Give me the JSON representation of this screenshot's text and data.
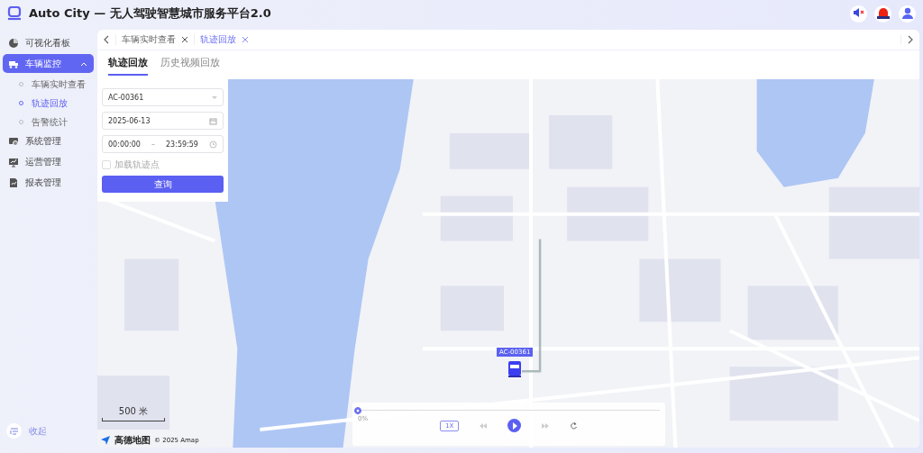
{
  "header": {
    "title": "Auto City — 无人驾驶智慧城市服务平台2.0"
  },
  "sidebar": {
    "items": [
      {
        "label": "可视化看板",
        "selected": false
      },
      {
        "label": "车辆监控",
        "selected": true,
        "expanded": true,
        "children": [
          {
            "label": "车辆实时查看",
            "selected": false
          },
          {
            "label": "轨迹回放",
            "selected": true
          },
          {
            "label": "告警统计",
            "selected": false
          }
        ]
      },
      {
        "label": "系统管理",
        "selected": false
      },
      {
        "label": "运营管理",
        "selected": false
      },
      {
        "label": "报表管理",
        "selected": false
      }
    ],
    "collapse_label": "收起"
  },
  "tab_strip": [
    {
      "label": "车辆实时查看",
      "selected": false
    },
    {
      "label": "轨迹回放",
      "selected": true
    }
  ],
  "page_tabs": [
    {
      "label": "轨迹回放",
      "selected": true
    },
    {
      "label": "历史视频回放",
      "selected": false
    }
  ],
  "query": {
    "vehicle": "AC-00361",
    "date": "2025-06-13",
    "start_time": "00:00:00",
    "separator": "–",
    "end_time": "23:59:59",
    "load_points": {
      "label": "加载轨迹点",
      "checked": false
    },
    "button": "查询"
  },
  "map": {
    "vehicle_label": "AC-00361",
    "scale": "500 米",
    "logo": "高德地图",
    "attribution": "© 2025 Amap"
  },
  "player": {
    "level": 0,
    "progress": "0%",
    "speed": "1X",
    "playing": false
  }
}
